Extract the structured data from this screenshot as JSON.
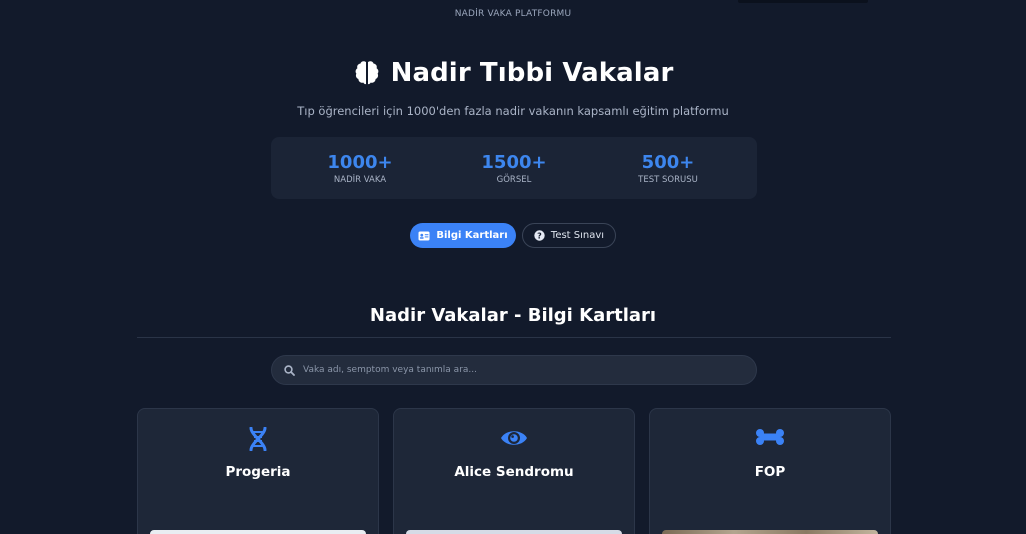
{
  "header": {
    "platform_label": "NADİR VAKA PLATFORMU"
  },
  "hero": {
    "icon": "brain-icon",
    "title": "Nadir Tıbbi Vakalar",
    "subtitle": "Tıp öğrencileri için 1000'den fazla nadir vakanın kapsamlı eğitim platformu"
  },
  "stats": [
    {
      "value": "1000+",
      "label": "NADİR VAKA"
    },
    {
      "value": "1500+",
      "label": "GÖRSEL"
    },
    {
      "value": "500+",
      "label": "TEST SORUSU"
    }
  ],
  "modes": {
    "flashcards_label": "Bilgi Kartları",
    "flashcards_icon": "id-card-icon",
    "quiz_label": "Test Sınavı",
    "quiz_icon": "question-circle-icon"
  },
  "section": {
    "title": "Nadir Vakalar - Bilgi Kartları"
  },
  "search": {
    "placeholder": "Vaka adı, semptom veya tanımla ara...",
    "value": ""
  },
  "cards": [
    {
      "title": "Progeria",
      "icon": "dna-icon"
    },
    {
      "title": "Alice Sendromu",
      "icon": "eye-icon"
    },
    {
      "title": "FOP",
      "icon": "bone-icon"
    }
  ],
  "colors": {
    "background": "#121a2b",
    "accent": "#3b82f6",
    "panel": "#1b2436"
  }
}
